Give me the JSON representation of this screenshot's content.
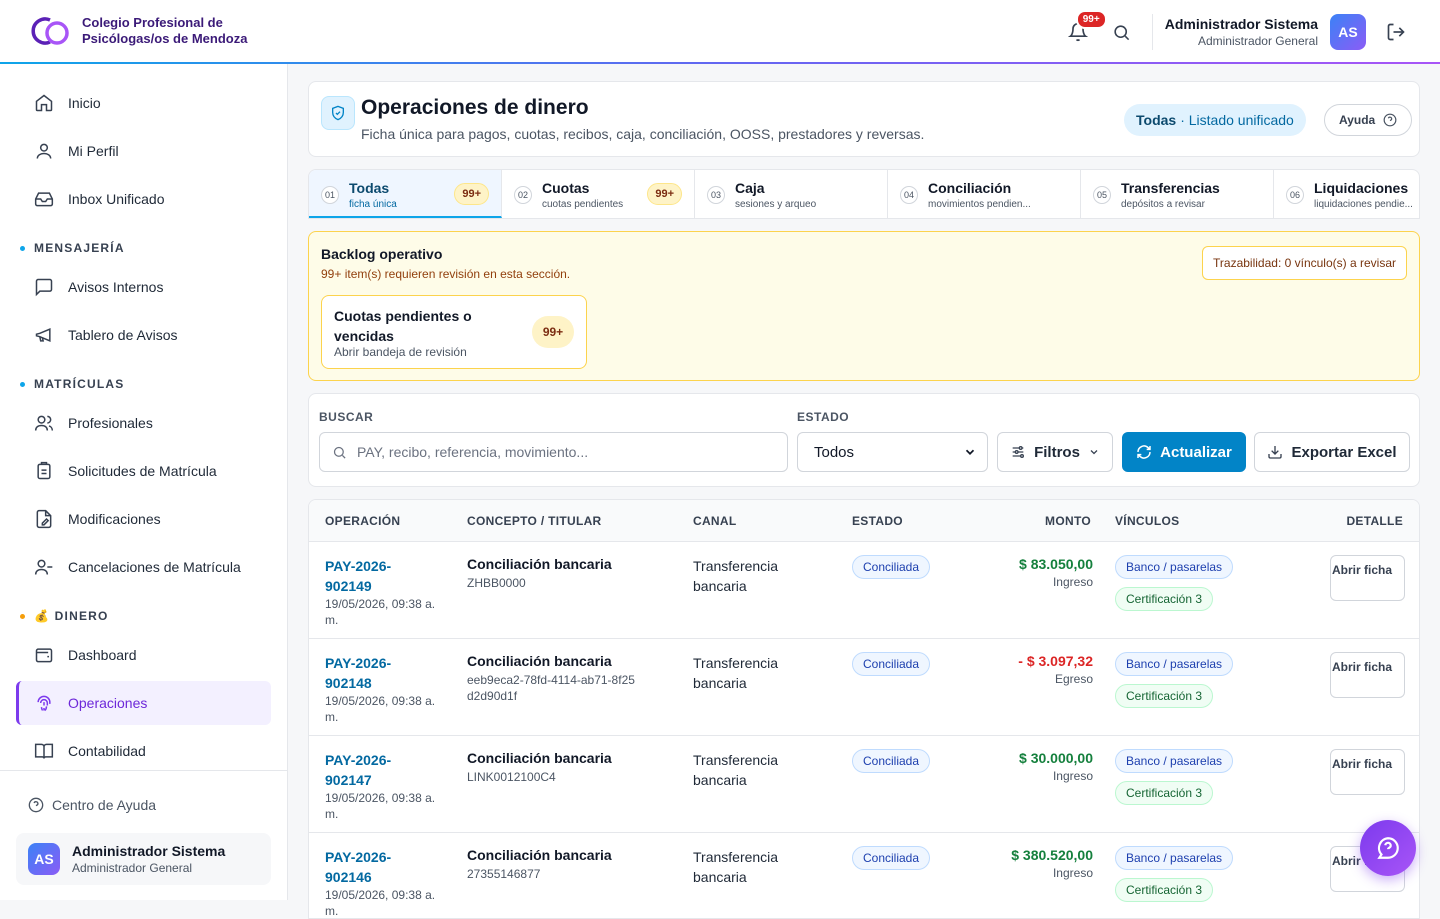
{
  "brand": {
    "line1": "Colegio Profesional de",
    "line2": "Psicólogas/os de Mendoza"
  },
  "topbar": {
    "notif_badge": "99+",
    "user_name": "Administrador Sistema",
    "user_role": "Administrador General",
    "avatar": "AS"
  },
  "sidebar": {
    "items_top": [
      {
        "label": "Inicio",
        "icon": "home-icon"
      },
      {
        "label": "Mi Perfil",
        "icon": "user-icon"
      },
      {
        "label": "Inbox Unificado",
        "icon": "inbox-icon"
      }
    ],
    "sec_mensajeria": "MENSAJERÍA",
    "items_msg": [
      {
        "label": "Avisos Internos"
      },
      {
        "label": "Tablero de Avisos"
      }
    ],
    "sec_matriculas": "MATRÍCULAS",
    "items_mat": [
      {
        "label": "Profesionales"
      },
      {
        "label": "Solicitudes de Matrícula"
      },
      {
        "label": "Modificaciones"
      },
      {
        "label": "Cancelaciones de Matrícula"
      }
    ],
    "sec_dinero": "💰 DINERO",
    "items_din": [
      {
        "label": "Dashboard"
      },
      {
        "label": "Operaciones"
      },
      {
        "label": "Contabilidad"
      }
    ],
    "help": "Centro de Ayuda",
    "user_name": "Administrador Sistema",
    "user_role": "Administrador General",
    "avatar": "AS"
  },
  "header": {
    "title": "Operaciones de dinero",
    "subtitle": "Ficha única para pagos, cuotas, recibos, caja, conciliación, OOSS, prestadores y reversas.",
    "scope_bold": "Todas",
    "scope_rest": "· Listado unificado",
    "help": "Ayuda"
  },
  "tabs": [
    {
      "num": "01",
      "label": "Todas",
      "sub": "ficha única",
      "count": "99+"
    },
    {
      "num": "02",
      "label": "Cuotas",
      "sub": "cuotas pendientes",
      "count": "99+"
    },
    {
      "num": "03",
      "label": "Caja",
      "sub": "sesiones y arqueo",
      "count": ""
    },
    {
      "num": "04",
      "label": "Conciliación",
      "sub": "movimientos pendien...",
      "count": ""
    },
    {
      "num": "05",
      "label": "Transferencias",
      "sub": "depósitos a revisar",
      "count": ""
    },
    {
      "num": "06",
      "label": "Liquidaciones",
      "sub": "liquidaciones pendie...",
      "count": ""
    }
  ],
  "backlog": {
    "title": "Backlog operativo",
    "subtitle": "99+ item(s) requieren revisión en esta sección.",
    "trace": "Trazabilidad: 0 vínculo(s) a revisar",
    "card_title": "Cuotas pendientes o vencidas",
    "card_sub": "Abrir bandeja de revisión",
    "card_count": "99+"
  },
  "filters": {
    "search_label": "BUSCAR",
    "search_placeholder": "PAY, recibo, referencia, movimiento...",
    "estado_label": "ESTADO",
    "estado_value": "Todos",
    "filtros": "Filtros",
    "actualizar": "Actualizar",
    "exportar": "Exportar Excel"
  },
  "table": {
    "headers": {
      "op": "OPERACIÓN",
      "concepto": "CONCEPTO / TITULAR",
      "canal": "CANAL",
      "estado": "ESTADO",
      "monto": "MONTO",
      "vinculos": "VÍNCULOS",
      "detalle": "DETALLE"
    },
    "rows": [
      {
        "id": "PAY-2026-902149",
        "date": "19/05/2026, 09:38 a. m.",
        "concept": "Conciliación bancaria",
        "ref": "ZHBB0000",
        "canal": "Transferencia bancaria",
        "estado": "Conciliada",
        "monto": "$ 83.050,00",
        "tipo": "Ingreso",
        "dir": "in",
        "chip1": "Banco / pasarelas",
        "chip2": "Certificación 3",
        "btn": "Abrir ficha"
      },
      {
        "id": "PAY-2026-902148",
        "date": "19/05/2026, 09:38 a. m.",
        "concept": "Conciliación bancaria",
        "ref": "eeb9eca2-78fd-4114-ab71-8f25d2d90d1f",
        "canal": "Transferencia bancaria",
        "estado": "Conciliada",
        "monto": "- $ 3.097,32",
        "tipo": "Egreso",
        "dir": "out",
        "chip1": "Banco / pasarelas",
        "chip2": "Certificación 3",
        "btn": "Abrir ficha"
      },
      {
        "id": "PAY-2026-902147",
        "date": "19/05/2026, 09:38 a. m.",
        "concept": "Conciliación bancaria",
        "ref": "LINK0012100C4",
        "canal": "Transferencia bancaria",
        "estado": "Conciliada",
        "monto": "$ 30.000,00",
        "tipo": "Ingreso",
        "dir": "in",
        "chip1": "Banco / pasarelas",
        "chip2": "Certificación 3",
        "btn": "Abrir ficha"
      },
      {
        "id": "PAY-2026-902146",
        "date": "19/05/2026, 09:38 a. m.",
        "concept": "Conciliación bancaria",
        "ref": "27355146877",
        "canal": "Transferencia bancaria",
        "estado": "Conciliada",
        "monto": "$ 380.520,00",
        "tipo": "Ingreso",
        "dir": "in",
        "chip1": "Banco / pasarelas",
        "chip2": "Certificación 3",
        "btn": "Abrir ficha"
      }
    ]
  }
}
